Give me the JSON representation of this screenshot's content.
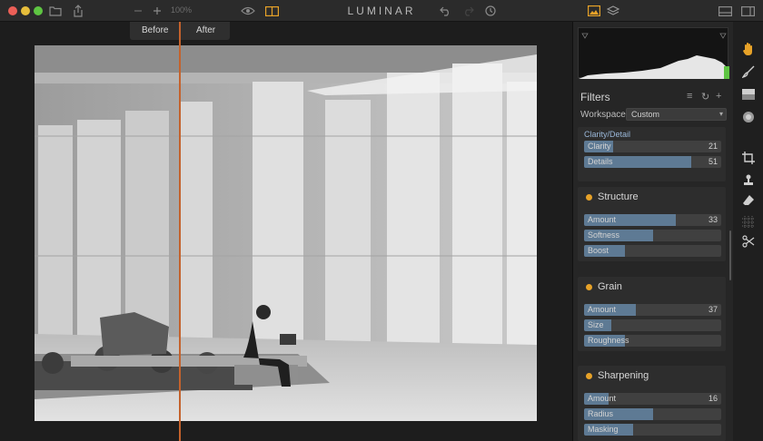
{
  "app": {
    "title": "LUMINAR",
    "zoom": "100%"
  },
  "toolbar": {
    "icons": [
      "folder-icon",
      "share-icon",
      "zoom-out-icon",
      "zoom-in-icon",
      "eye-icon",
      "compare-icon",
      "undo-icon",
      "redo-icon",
      "history-icon",
      "image-icon",
      "layers-icon",
      "panel-bottom-icon",
      "panel-right-icon"
    ]
  },
  "compare": {
    "before": "Before",
    "after": "After",
    "split_fraction": 0.29
  },
  "filters": {
    "title": "Filters",
    "workspace_label": "Workspace:",
    "workspace_value": "Custom",
    "clarity_detail": {
      "title": "Clarity/Detail",
      "sliders": [
        {
          "label": "Clarity",
          "value": "21",
          "fill": 0.21
        },
        {
          "label": "Details",
          "value": "51",
          "fill": 0.78
        }
      ]
    },
    "sections": [
      {
        "title": "Structure",
        "sliders": [
          {
            "label": "Amount",
            "value": "33",
            "fill": 0.67
          },
          {
            "label": "Softness",
            "value": "",
            "fill": 0.5
          },
          {
            "label": "Boost",
            "value": "",
            "fill": 0.3
          }
        ]
      },
      {
        "title": "Grain",
        "sliders": [
          {
            "label": "Amount",
            "value": "37",
            "fill": 0.38
          },
          {
            "label": "Size",
            "value": "",
            "fill": 0.2
          },
          {
            "label": "Roughness",
            "value": "",
            "fill": 0.3
          }
        ]
      },
      {
        "title": "Sharpening",
        "sliders": [
          {
            "label": "Amount",
            "value": "16",
            "fill": 0.18
          },
          {
            "label": "Radius",
            "value": "",
            "fill": 0.5
          },
          {
            "label": "Masking",
            "value": "",
            "fill": 0.36
          }
        ]
      }
    ]
  },
  "tools": [
    "hand-icon",
    "brush-icon",
    "gradient-icon",
    "radial-icon",
    "crop-icon",
    "stamp-icon",
    "eraser-icon",
    "texture-icon",
    "scissors-icon"
  ],
  "colors": {
    "accent": "#e7a228",
    "split": "#c4622c",
    "slider": "#5e7a94"
  }
}
